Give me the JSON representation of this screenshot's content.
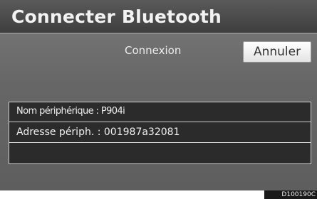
{
  "header": {
    "title": "Connecter Bluetooth"
  },
  "status": {
    "text": "Connexion"
  },
  "actions": {
    "cancel_label": "Annuler"
  },
  "device_info": {
    "rows": [
      {
        "text": "Nom périphérique : P904i"
      },
      {
        "text": "Adresse périph. : 001987a32081"
      },
      {
        "text": ""
      }
    ]
  },
  "figure": {
    "code": "D100190C"
  }
}
